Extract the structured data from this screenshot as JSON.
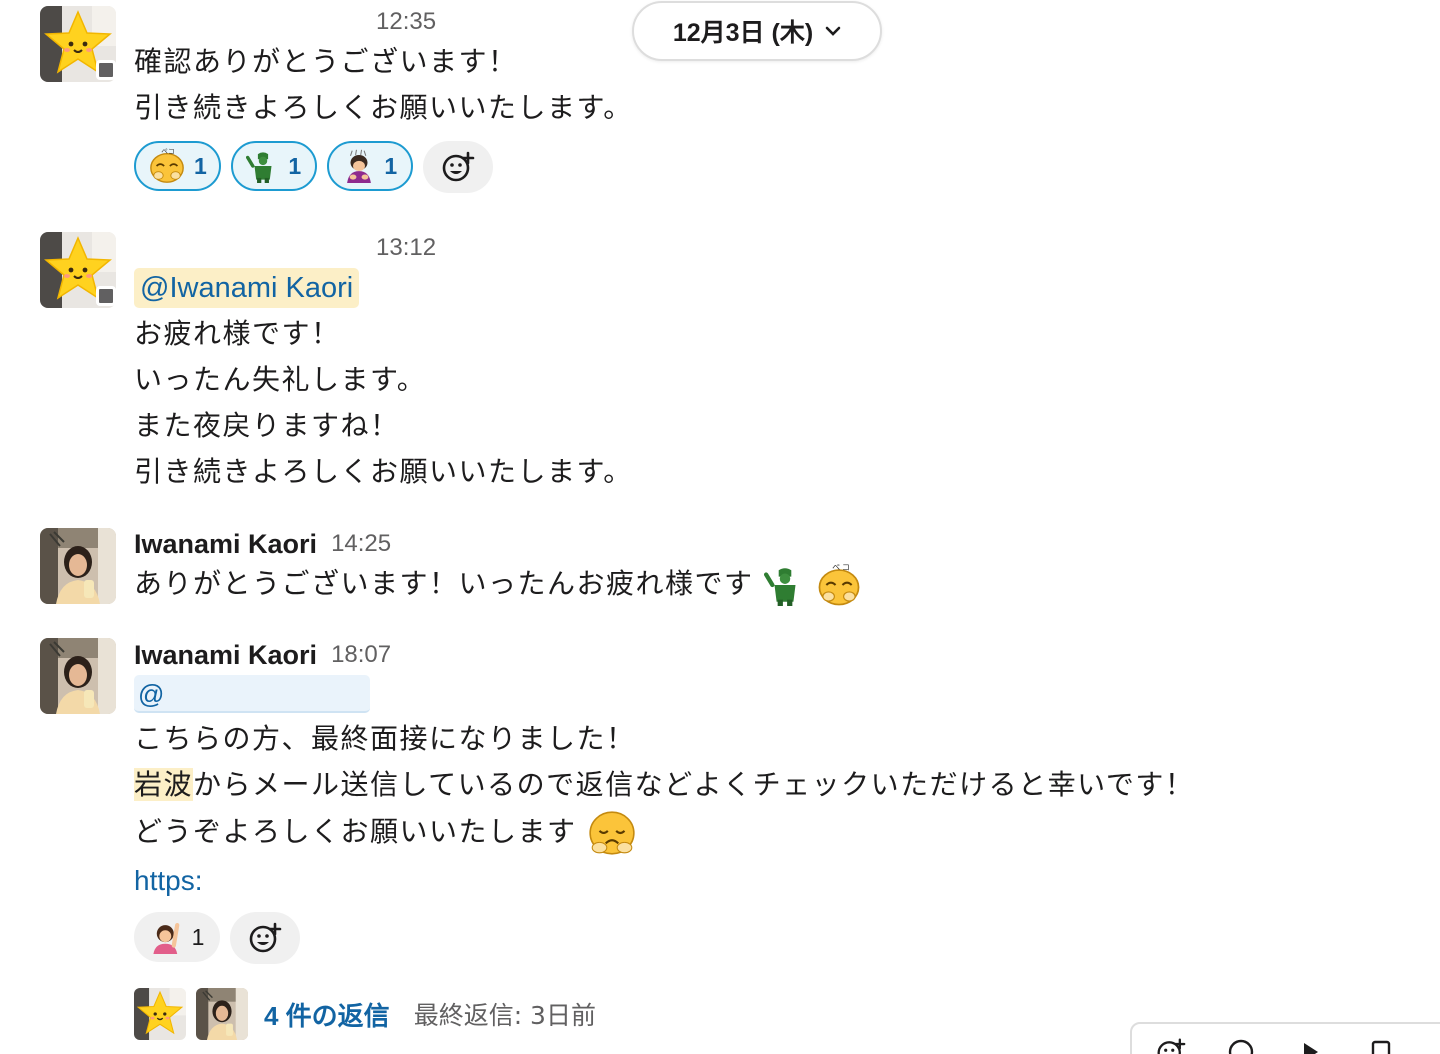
{
  "date_divider": {
    "label": "12月3日 (木)",
    "icon": "chevron-down-icon"
  },
  "messages": [
    {
      "author": "",
      "time": "12:35",
      "lines": [
        "確認ありがとうございます！",
        "引き続きよろしくお願いいたします。"
      ],
      "reactions": [
        {
          "emoji": "bowing-face-emoji",
          "count": "1"
        },
        {
          "emoji": "saluting-soldier-emoji",
          "count": "1"
        },
        {
          "emoji": "person-bowing-emoji",
          "count": "1"
        }
      ]
    },
    {
      "author": "",
      "time": "13:12",
      "mention": "@Iwanami Kaori",
      "lines": [
        "お疲れ様です！",
        "いったん失礼します。",
        "また夜戻りますね！",
        "引き続きよろしくお願いいたします。"
      ]
    },
    {
      "author": "Iwanami Kaori",
      "time": "14:25",
      "lines": [
        "ありがとうございます！いったんお疲れ様です"
      ]
    },
    {
      "author": "Iwanami Kaori",
      "time": "18:07",
      "mention": "@",
      "lines": [
        "こちらの方、最終面接になりました！"
      ],
      "highlight_word": "岩波",
      "line_after_highlight": "からメール送信しているので返信などよくチェックいただけると幸いです！",
      "line_last": "どうぞよろしくお願いいたします",
      "link": "https:",
      "reactions": [
        {
          "emoji": "person-raising-hand-emoji",
          "count": "1"
        }
      ]
    }
  ],
  "thread": {
    "replies_label": "4 件の返信",
    "last_reply": "最終返信: 3日前"
  },
  "colors": {
    "link": "#1264a3",
    "mention_bg": "#fcefc7",
    "reaction_border": "#1d9bd1",
    "reaction_bg": "#e8f5fa"
  }
}
